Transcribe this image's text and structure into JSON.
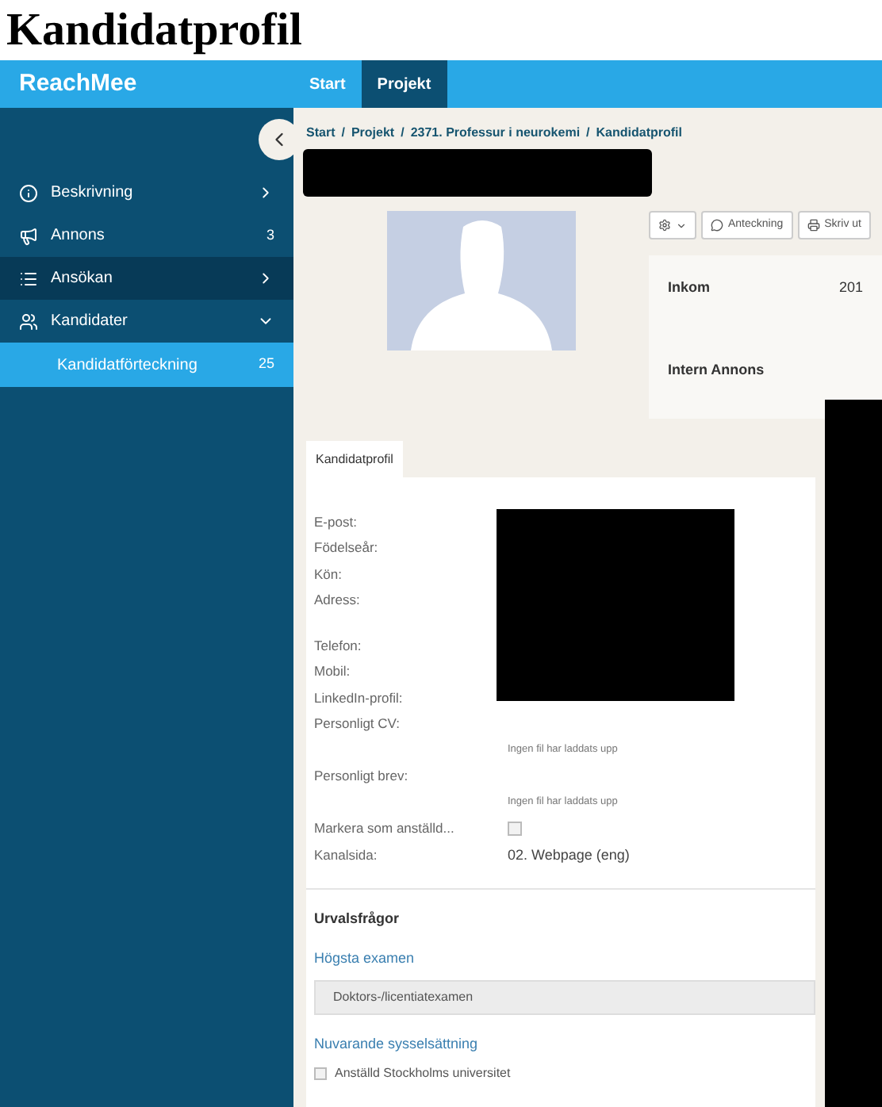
{
  "page_title": "Kandidatprofil",
  "app": {
    "logo": "ReachMee",
    "nav_tabs": [
      {
        "label": "Start",
        "selected": false
      },
      {
        "label": "Projekt",
        "selected": true
      }
    ],
    "sidebar": {
      "items": [
        {
          "label": "Beskrivning",
          "kind": "info",
          "expanded": false,
          "highlighted": false
        },
        {
          "label": "Annons",
          "kind": "megaphone",
          "count": "3",
          "highlighted": false
        },
        {
          "label": "Ansökan",
          "kind": "list",
          "expanded": false,
          "highlighted": true
        },
        {
          "label": "Kandidater",
          "kind": "people",
          "highlighted": false,
          "expanded": true,
          "children": [
            {
              "label": "Kandidatförteckning",
              "count": "25",
              "selected": true
            }
          ]
        }
      ]
    },
    "breadcrumb_separator": "/",
    "breadcrumb": [
      "Start",
      "Projekt",
      "2371. Professur i neurokemi",
      "Kandidatprofil"
    ],
    "toolbar": [
      {
        "kind": "gear"
      },
      {
        "kind": "comment",
        "label": "Anteckning"
      },
      {
        "kind": "print",
        "label": "Skriv ut"
      }
    ],
    "info_card": [
      {
        "label": "Inkom",
        "value": "201"
      },
      {
        "label": "Intern Annons"
      }
    ],
    "tabs": [
      {
        "label": "Kandidatprofil",
        "selected": true
      }
    ],
    "field_groups": [
      [
        {
          "label": "E-post:",
          "kind": "text"
        },
        {
          "label": "Födelseår:",
          "kind": "text"
        },
        {
          "label": "Kön:",
          "kind": "text"
        },
        {
          "label": "Adress:",
          "kind": "text"
        }
      ],
      [
        {
          "label": "Telefon:",
          "kind": "text"
        },
        {
          "label": "Mobil:",
          "kind": "text"
        },
        {
          "label": "LinkedIn-profil:",
          "kind": "text"
        },
        {
          "label": "Personligt CV:",
          "kind": "file",
          "value": "Ingen fil har laddats upp"
        },
        {
          "label": "Personligt brev:",
          "kind": "file",
          "value": "Ingen fil har laddats upp"
        },
        {
          "label": "Markera som anställd...",
          "kind": "checkbox",
          "checked": false
        },
        {
          "label": "Kanalsida:",
          "kind": "text",
          "value": "02. Webpage (eng)"
        }
      ]
    ],
    "questions_title": "Urvalsfrågor",
    "questions": [
      {
        "question": "Högsta examen",
        "kind": "answer",
        "answer": "Doktors-/licentiatexamen"
      },
      {
        "question": "Nuvarande sysselsättning",
        "kind": "checkbox",
        "options": [
          {
            "label": "Anställd Stockholms universitet",
            "checked": false
          }
        ]
      }
    ]
  }
}
